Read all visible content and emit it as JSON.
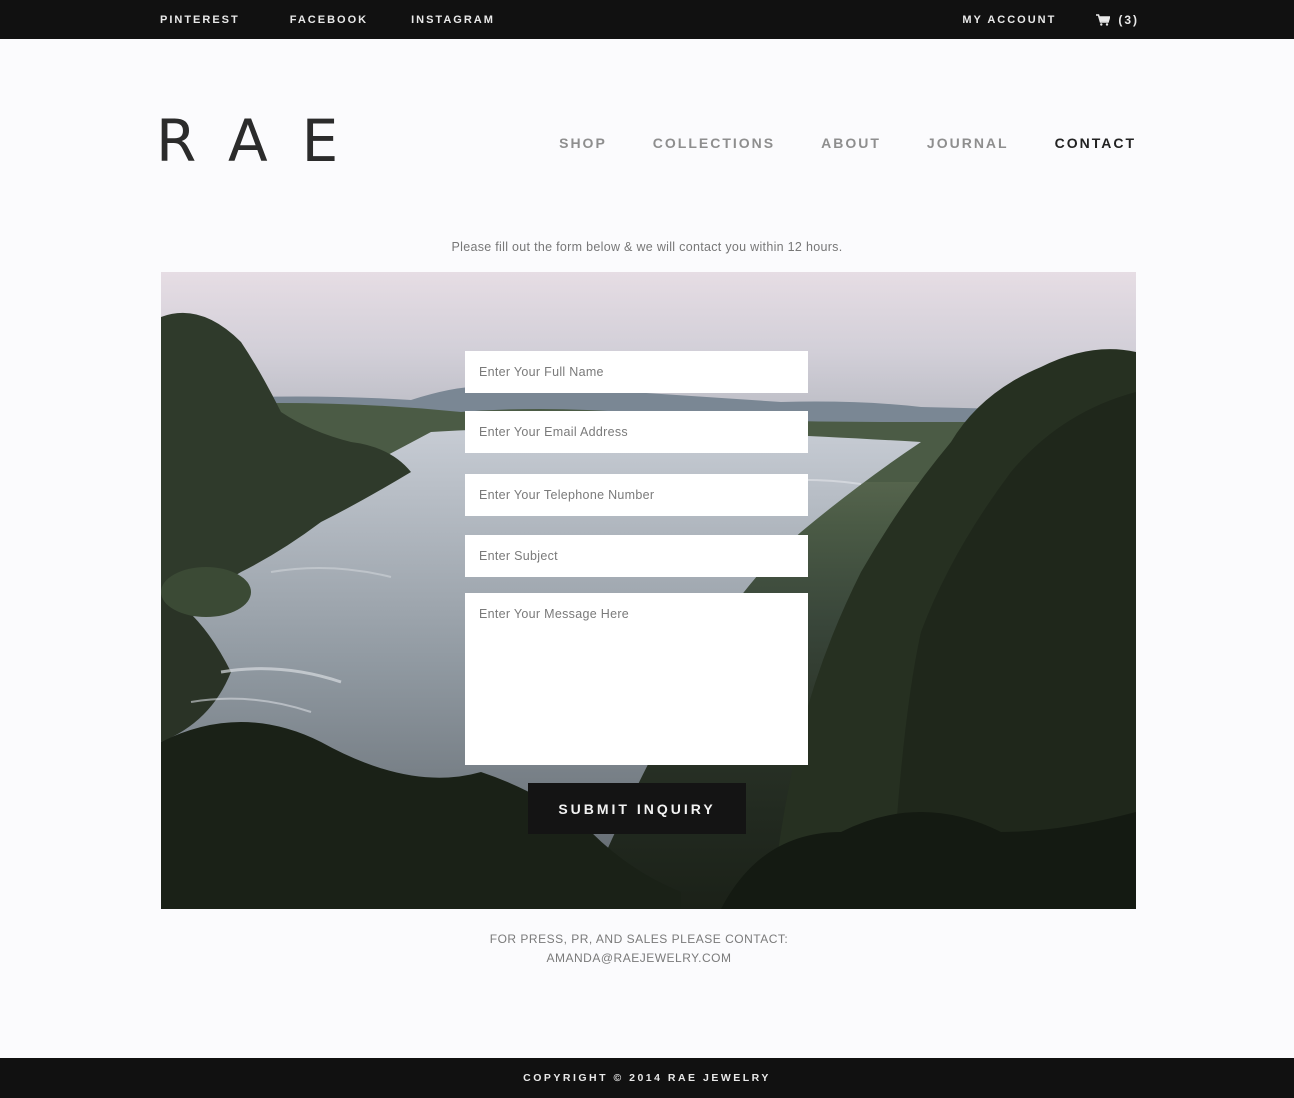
{
  "topbar": {
    "social": [
      "PINTEREST",
      "FACEBOOK",
      "INSTAGRAM"
    ],
    "account_label": "MY ACCOUNT",
    "cart_count": "(3)"
  },
  "header": {
    "logo": "RAE",
    "nav": [
      "SHOP",
      "COLLECTIONS",
      "ABOUT",
      "JOURNAL",
      "CONTACT"
    ],
    "active_nav": "CONTACT"
  },
  "intro": "Please fill out the form below & we will contact you within 12 hours.",
  "form": {
    "name_placeholder": "Enter Your Full Name",
    "email_placeholder": "Enter Your Email Address",
    "phone_placeholder": "Enter Your Telephone Number",
    "subject_placeholder": "Enter Subject",
    "message_placeholder": "Enter Your Message Here",
    "submit_label": "SUBMIT INQUIRY"
  },
  "press": {
    "line1": "FOR PRESS, PR, AND SALES PLEASE CONTACT:",
    "email": "AMANDA@RAEJEWELRY.COM"
  },
  "footer": {
    "copyright": "COPYRIGHT © 2014 RAE JEWELRY"
  }
}
